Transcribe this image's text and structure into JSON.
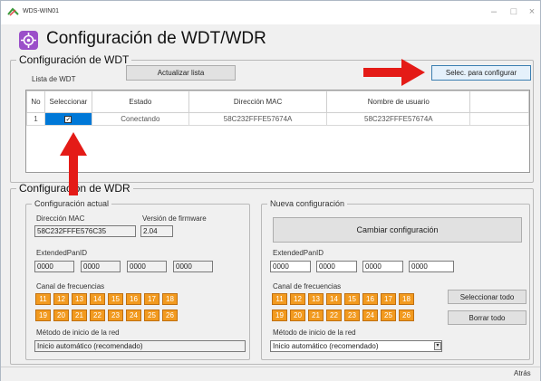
{
  "window": {
    "title": "WDS-WIN01",
    "minimize": "–",
    "maximize": "□",
    "close": "×"
  },
  "header": {
    "title": "Configuración de WDT/WDR"
  },
  "wdt": {
    "legend": "Configuración de WDT",
    "list_label": "Lista de WDT",
    "refresh_button": "Actualizar lista",
    "select_button": "Selec. para configurar",
    "columns": [
      "No",
      "Seleccionar",
      "Estado",
      "Dirección MAC",
      "Nombre de usuario"
    ],
    "rows": [
      {
        "no": "1",
        "selected": "✓",
        "status": "Conectando",
        "mac": "58C232FFFE57674A",
        "user": "58C232FFFE57674A"
      }
    ]
  },
  "wdr": {
    "legend": "Configuración de WDR",
    "current": {
      "legend": "Configuración actual",
      "mac_label": "Dirección MAC",
      "mac_value": "58C232FFFE576C35",
      "fw_label": "Versión de firmware",
      "fw_value": "2.04",
      "panid_label": "ExtendedPanID",
      "panid": [
        "0000",
        "0000",
        "0000",
        "0000"
      ],
      "channel_label": "Canal de frecuencias",
      "channels": [
        "11",
        "12",
        "13",
        "14",
        "15",
        "16",
        "17",
        "18",
        "19",
        "20",
        "21",
        "22",
        "23",
        "24",
        "25",
        "26"
      ],
      "method_label": "Método de inicio de la red",
      "method_value": "Inicio automático (recomendado)"
    },
    "new": {
      "legend": "Nueva configuración",
      "change_button": "Cambiar configuración",
      "panid_label": "ExtendedPanID",
      "panid": [
        "0000",
        "0000",
        "0000",
        "0000"
      ],
      "channel_label": "Canal de frecuencias",
      "channels": [
        "11",
        "12",
        "13",
        "14",
        "15",
        "16",
        "17",
        "18",
        "19",
        "20",
        "21",
        "22",
        "23",
        "24",
        "25",
        "26"
      ],
      "select_all": "Seleccionar todo",
      "clear_all": "Borrar todo",
      "method_label": "Método de inicio de la red",
      "method_value": "Inicio automático (recomendado)"
    }
  },
  "footer": {
    "back_button": "Atrás"
  },
  "colors": {
    "arrow": "#e41b17",
    "channel": "#f29a1f",
    "selection": "#0078d7"
  }
}
